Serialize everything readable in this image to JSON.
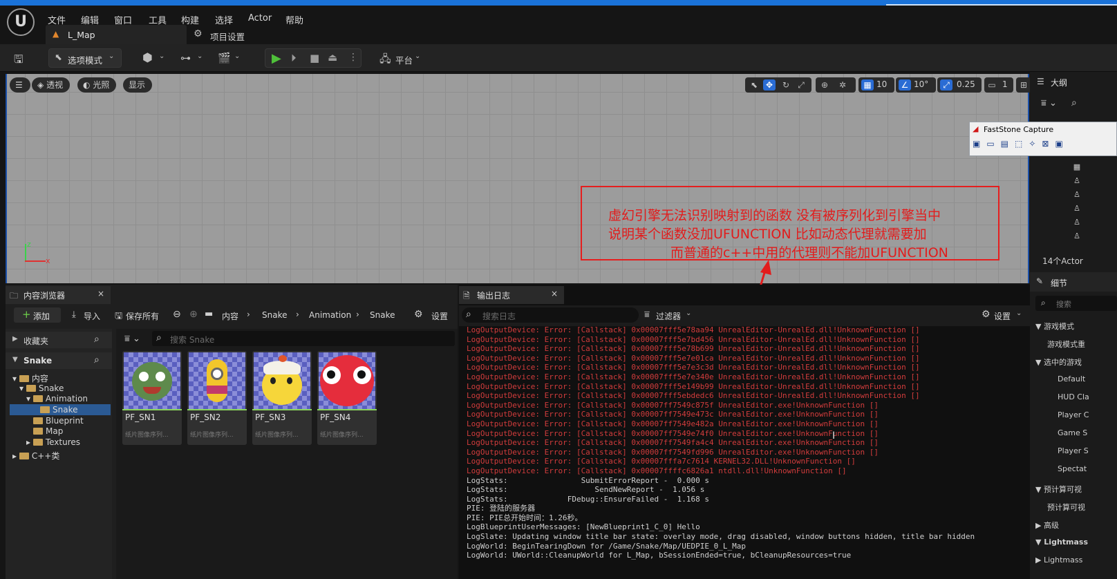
{
  "app": {
    "menu": [
      "文件",
      "编辑",
      "窗口",
      "工具",
      "构建",
      "选择",
      "Actor",
      "帮助"
    ],
    "tabs": {
      "map": "L_Map",
      "project_settings": "项目设置"
    }
  },
  "toolbar": {
    "mode": "选项模式",
    "platform": "平台"
  },
  "viewport": {
    "perspective": "透视",
    "lighting": "光照",
    "show": "显示",
    "grid_snap": "10",
    "rotation_snap": "10°",
    "scale_snap": "0.25",
    "camera_speed": "1",
    "axis_x": "x",
    "axis_z": "z"
  },
  "annotation": {
    "line1": "虚幻引擎无法识别映射到的函数  没有被序列化到引擎当中",
    "line2": "说明某个函数没加UFUNCTION    比如动态代理就需要加",
    "line3": "而普通的c++中用的代理则不能加UFUNCTION",
    "color": "#e21c1c"
  },
  "outliner": {
    "title": "大纲",
    "actor_count": "14个Actor",
    "details_title": "细节",
    "search_placeholder": "搜索",
    "sections": [
      "游戏模式",
      "游戏模式重",
      "选中的游戏",
      "Default",
      "HUD Cla",
      "Player C",
      "Game S",
      "Player S",
      "Spectat",
      "预计算可视",
      "预计算可视",
      "高级",
      "Lightmass",
      "Lightmass"
    ]
  },
  "faststone": {
    "title": "FastStone Capture"
  },
  "content_browser": {
    "tab": "内容浏览器",
    "add": "添加",
    "import": "导入",
    "save_all": "保存所有",
    "breadcrumb": [
      "内容",
      "Snake",
      "Animation",
      "Snake"
    ],
    "settings": "设置",
    "favorites": "收藏夹",
    "project": "Snake",
    "search_placeholder": "搜索 Snake",
    "tree": [
      "内容",
      "Snake",
      "Animation",
      "Snake",
      "Blueprint",
      "Map",
      "Textures",
      "C++类"
    ],
    "assets": [
      {
        "name": "PF_SN1",
        "type": "纸片图像序列..."
      },
      {
        "name": "PF_SN2",
        "type": "纸片图像序列..."
      },
      {
        "name": "PF_SN3",
        "type": "纸片图像序列..."
      },
      {
        "name": "PF_SN4",
        "type": "纸片图像序列..."
      }
    ]
  },
  "output_log": {
    "tab": "输出日志",
    "search_placeholder": "搜索日志",
    "filter": "过滤器",
    "settings": "设置",
    "lines": [
      {
        "t": "LogOutputDevice: Error: [Callstack] 0x00007fff5e78aa94 UnrealEditor-UnrealEd.dll!UnknownFunction []",
        "k": "err"
      },
      {
        "t": "LogOutputDevice: Error: [Callstack] 0x00007fff5e7bd456 UnrealEditor-UnrealEd.dll!UnknownFunction []",
        "k": "err"
      },
      {
        "t": "LogOutputDevice: Error: [Callstack] 0x00007fff5e78b699 UnrealEditor-UnrealEd.dll!UnknownFunction []",
        "k": "err"
      },
      {
        "t": "LogOutputDevice: Error: [Callstack] 0x00007fff5e7e01ca UnrealEditor-UnrealEd.dll!UnknownFunction []",
        "k": "err"
      },
      {
        "t": "LogOutputDevice: Error: [Callstack] 0x00007fff5e7e3c3d UnrealEditor-UnrealEd.dll!UnknownFunction []",
        "k": "err"
      },
      {
        "t": "LogOutputDevice: Error: [Callstack] 0x00007fff5e7e340e UnrealEditor-UnrealEd.dll!UnknownFunction []",
        "k": "err"
      },
      {
        "t": "LogOutputDevice: Error: [Callstack] 0x00007fff5e149b99 UnrealEditor-UnrealEd.dll!UnknownFunction []",
        "k": "err"
      },
      {
        "t": "LogOutputDevice: Error: [Callstack] 0x00007fff5ebdedc6 UnrealEditor-UnrealEd.dll!UnknownFunction []",
        "k": "err"
      },
      {
        "t": "LogOutputDevice: Error: [Callstack] 0x00007ff7549c875f UnrealEditor.exe!UnknownFunction []",
        "k": "err"
      },
      {
        "t": "LogOutputDevice: Error: [Callstack] 0x00007ff7549e473c UnrealEditor.exe!UnknownFunction []",
        "k": "err"
      },
      {
        "t": "LogOutputDevice: Error: [Callstack] 0x00007ff7549e482a UnrealEditor.exe!UnknownFunction []",
        "k": "err"
      },
      {
        "t": "LogOutputDevice: Error: [Callstack] 0x00007ff7549e74f0 UnrealEditor.exe!UnknownFunction []",
        "k": "err"
      },
      {
        "t": "LogOutputDevice: Error: [Callstack] 0x00007ff7549fa4c4 UnrealEditor.exe!UnknownFunction []",
        "k": "err"
      },
      {
        "t": "LogOutputDevice: Error: [Callstack] 0x00007ff7549fd996 UnrealEditor.exe!UnknownFunction []",
        "k": "err"
      },
      {
        "t": "LogOutputDevice: Error: [Callstack] 0x00007fffa7c7614 KERNEL32.DLL!UnknownFunction []",
        "k": "err"
      },
      {
        "t": "LogOutputDevice: Error: [Callstack] 0x00007ffffc6826a1 ntdll.dll!UnknownFunction []",
        "k": "err"
      },
      {
        "t": "LogStats:                SubmitErrorReport -  0.000 s",
        "k": "nrm"
      },
      {
        "t": "LogStats:                   SendNewReport -  1.056 s",
        "k": "nrm"
      },
      {
        "t": "LogStats:             FDebug::EnsureFailed -  1.168 s",
        "k": "nrm"
      },
      {
        "t": "PIE: 登陆的服务器",
        "k": "nrm"
      },
      {
        "t": "PIE: PIE总开始时间：1.26秒。",
        "k": "nrm"
      },
      {
        "t": "LogBlueprintUserMessages: [NewBlueprint1_C_0] Hello",
        "k": "nrm"
      },
      {
        "t": "LogSlate: Updating window title bar state: overlay mode, drag disabled, window buttons hidden, title bar hidden",
        "k": "nrm"
      },
      {
        "t": "LogWorld: BeginTearingDown for /Game/Snake/Map/UEDPIE_0_L_Map",
        "k": "nrm"
      },
      {
        "t": "LogWorld: UWorld::CleanupWorld for L_Map, bSessionEnded=true, bCleanupResources=true",
        "k": "nrm"
      }
    ]
  }
}
